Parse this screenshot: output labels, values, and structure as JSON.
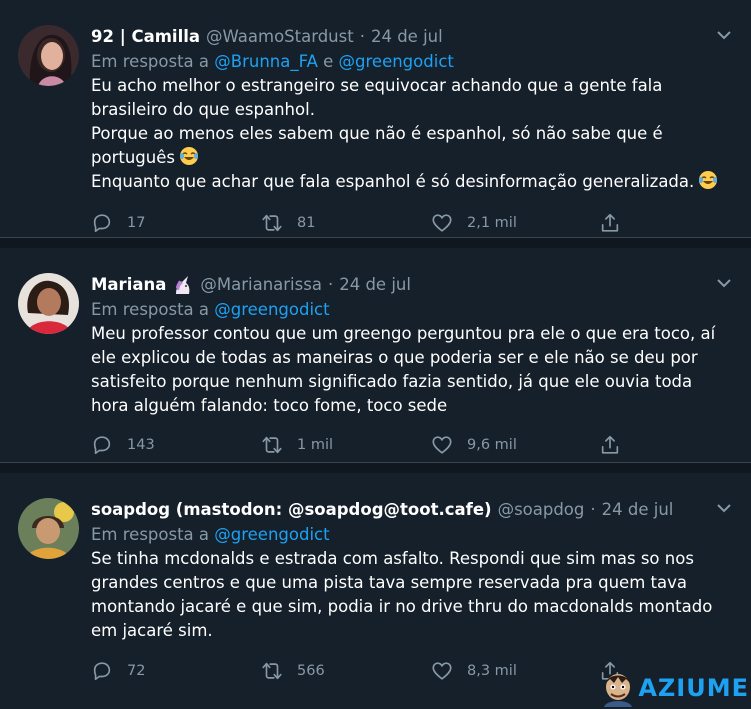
{
  "tweets": [
    {
      "name": "92 | Camilla",
      "handle": "@WaamoStardust",
      "time": "24 de jul",
      "reply_prefix": "Em resposta a",
      "reply_mention1": "@Brunna_FA",
      "reply_join": "e",
      "reply_mention2": "@greengodict",
      "lines": [
        "Eu acho melhor o estrangeiro se equivocar achando que a gente fala",
        "brasileiro do que espanhol.",
        "Porque ao menos eles sabem que não é espanhol, só não sabe que é",
        "português",
        "Enquanto que achar que fala espanhol é só desinformação generalizada."
      ],
      "replies": "17",
      "retweets": "81",
      "likes": "2,1 mil"
    },
    {
      "name": "Mariana",
      "name_emoji": "unicorn",
      "handle": "@Marianarissa",
      "time": "24 de jul",
      "reply_prefix": "Em resposta a",
      "reply_mention1": "@greengodict",
      "lines": [
        "Meu professor contou que um greengo perguntou pra ele o que era toco, aí",
        "ele explicou de todas as maneiras o que poderia ser e ele não se deu por",
        "satisfeito porque nenhum significado fazia sentido, já que ele ouvia toda",
        "hora alguém falando: toco fome, toco sede"
      ],
      "replies": "143",
      "retweets": "1 mil",
      "likes": "9,6 mil"
    },
    {
      "name": "soapdog (mastodon: @soapdog@toot.cafe)",
      "handle": "@soapdog",
      "time": "24 de jul",
      "reply_prefix": "Em resposta a",
      "reply_mention1": "@greengodict",
      "lines": [
        "Se tinha mcdonalds e estrada com asfalto. Respondi que sim mas so nos",
        "grandes centros e que uma pista tava sempre reservada pra quem tava",
        "montando jacaré e que sim, podia ir no drive thru do macdonalds montado",
        "em jacaré sim."
      ],
      "replies": "72",
      "retweets": "566",
      "likes": "8,3 mil"
    }
  ],
  "icons": {
    "reply": "reply-icon",
    "retweet": "retweet-icon",
    "like": "heart-icon",
    "share": "share-icon",
    "more": "chevron-down-icon"
  },
  "colors": {
    "background": "#15202b",
    "separator": "#10171e",
    "secondary_text": "#8899a6",
    "accent": "#1da1f2"
  },
  "watermark": {
    "text": "AZIUME"
  }
}
